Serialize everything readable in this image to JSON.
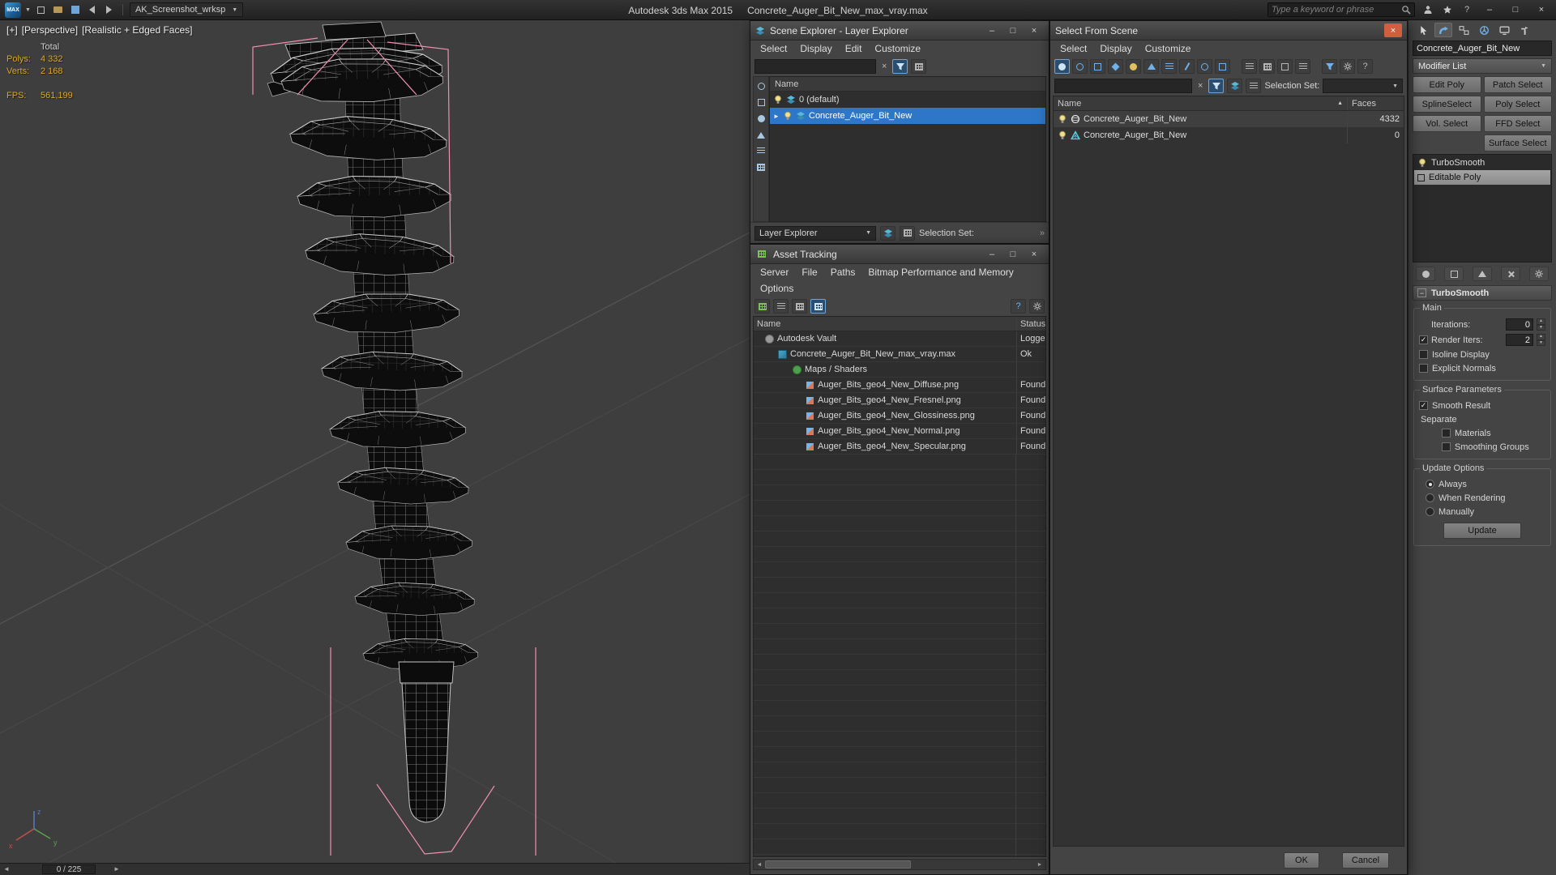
{
  "icons": {
    "close": "×",
    "minimize": "–",
    "maximize": "□",
    "dropdown": "▼",
    "clear": "×",
    "check": "✓",
    "sort_asc": "▲",
    "expand": "►",
    "spin_up": "▲",
    "spin_down": "▼",
    "prev": "◄",
    "next": "►",
    "help": "?",
    "chevrons": "»",
    "collapse": "−"
  },
  "titlebar": {
    "logo_text": "MAX",
    "workspace": "AK_Screenshot_wrksp",
    "app_title": "Autodesk 3ds Max 2015",
    "document_title": "Concrete_Auger_Bit_New_max_vray.max",
    "search_placeholder": "Type a keyword or phrase"
  },
  "viewport": {
    "label_general": "[+]",
    "label_pov": "[Perspective]",
    "label_shading": "[Realistic + Edged Faces]",
    "stats": {
      "total_label": "Total",
      "polys_label": "Polys:",
      "polys_value": "4 332",
      "verts_label": "Verts:",
      "verts_value": "2 168",
      "fps_label": "FPS:",
      "fps_value": "561,199"
    },
    "axis": {
      "x": "x",
      "y": "y",
      "z": "z"
    },
    "frame_indicator": "0 / 225"
  },
  "scene_explorer": {
    "title": "Scene Explorer - Layer Explorer",
    "menus": [
      "Select",
      "Display",
      "Edit",
      "Customize"
    ],
    "name_header": "Name",
    "rows": [
      {
        "label": "0 (default)"
      },
      {
        "label": "Concrete_Auger_Bit_New"
      }
    ],
    "footer": {
      "mode": "Layer Explorer",
      "selection_set_label": "Selection Set:"
    }
  },
  "asset_tracking": {
    "title": "Asset Tracking",
    "menus": [
      "Server",
      "File",
      "Paths",
      "Bitmap Performance and Memory",
      "Options"
    ],
    "columns": [
      "Name",
      "Status"
    ],
    "rows": [
      {
        "name": "Autodesk Vault",
        "status": "Logge"
      },
      {
        "name": "Concrete_Auger_Bit_New_max_vray.max",
        "status": "Ok"
      },
      {
        "name": "Maps / Shaders",
        "status": ""
      },
      {
        "name": "Auger_Bits_geo4_New_Diffuse.png",
        "status": "Found"
      },
      {
        "name": "Auger_Bits_geo4_New_Fresnel.png",
        "status": "Found"
      },
      {
        "name": "Auger_Bits_geo4_New_Glossiness.png",
        "status": "Found"
      },
      {
        "name": "Auger_Bits_geo4_New_Normal.png",
        "status": "Found"
      },
      {
        "name": "Auger_Bits_geo4_New_Specular.png",
        "status": "Found"
      }
    ]
  },
  "select_from_scene": {
    "title": "Select From Scene",
    "menus": [
      "Select",
      "Display",
      "Customize"
    ],
    "selection_set_label": "Selection Set:",
    "name_header": "Name",
    "faces_header": "Faces",
    "rows": [
      {
        "name": "Concrete_Auger_Bit_New",
        "faces": "4332"
      },
      {
        "name": "Concrete_Auger_Bit_New",
        "faces": "0"
      }
    ],
    "ok_label": "OK",
    "cancel_label": "Cancel"
  },
  "command_panel": {
    "object_name": "Concrete_Auger_Bit_New",
    "modifier_list_label": "Modifier List",
    "modifier_buttons": [
      "Edit Poly",
      "Patch Select",
      "SplineSelect",
      "Poly Select",
      "Vol. Select",
      "FFD Select",
      "Surface Select"
    ],
    "stack": [
      {
        "label": "TurboSmooth"
      },
      {
        "label": "Editable Poly"
      }
    ],
    "rollout_title": "TurboSmooth",
    "groups": {
      "main": {
        "title": "Main",
        "iterations_label": "Iterations:",
        "iterations_value": "0",
        "render_iters_label": "Render Iters:",
        "render_iters_value": "2",
        "isoline_label": "Isoline Display",
        "explicit_label": "Explicit Normals"
      },
      "surface": {
        "title": "Surface Parameters",
        "smooth_result": "Smooth Result",
        "separate": "Separate",
        "materials": "Materials",
        "smoothing_groups": "Smoothing Groups"
      },
      "update": {
        "title": "Update Options",
        "always": "Always",
        "when_rendering": "When Rendering",
        "manually": "Manually",
        "update_button": "Update"
      }
    }
  }
}
